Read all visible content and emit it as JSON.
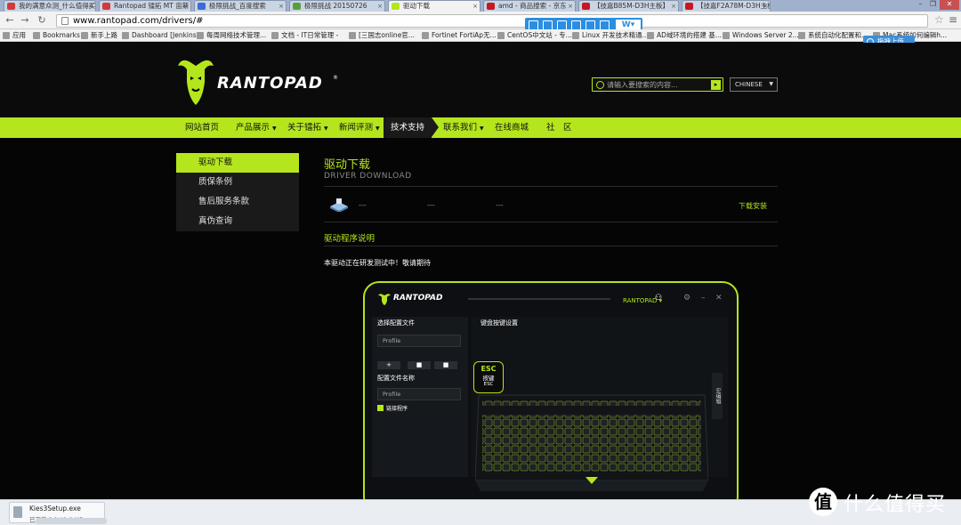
{
  "browser": {
    "tabs": [
      {
        "title": "我的满意众测_什么值得买",
        "fav_color": "#d43a3a"
      },
      {
        "title": "Rantopad 镭拓 MT 宙斯",
        "fav_color": "#d43a3a"
      },
      {
        "title": "极限挑战_百度搜索",
        "fav_color": "#3b6bd6"
      },
      {
        "title": "极限挑战 20150726",
        "fav_color": "#5a9e3c"
      },
      {
        "title": "驱动下载",
        "fav_color": "#b5e61d"
      },
      {
        "title": "amd - 商品搜索 - 京东",
        "fav_color": "#c81623"
      },
      {
        "title": "【技嘉B85M-D3H主板】",
        "fav_color": "#c81623"
      },
      {
        "title": "【技嘉F2A78M-D3H主板】",
        "fav_color": "#c81623"
      }
    ],
    "url": "www.rantopad.com/drivers/#",
    "bookmarks": [
      "应用",
      "Bookmarks",
      "新手上路",
      "Dashboard [Jenkins]",
      "每周网络技术管理...",
      "文档 - IT日常管理 -",
      "[三国志online官...",
      "Fortinet FortiAp无...",
      "CentOS中文站 - 专...",
      "Linux 开发技术精通...",
      "AD域环境的搭建 基...",
      "Windows Server 2...",
      "系统自动化配置和...",
      "Mac系统如何编辑h..."
    ],
    "upload_label": "拖拽上传"
  },
  "site": {
    "brand": "RANTOPAD",
    "search_placeholder": "请输入要搜索的内容...",
    "language": "CHINESE",
    "nav": [
      {
        "label": "网站首页",
        "dropdown": false
      },
      {
        "label": "产品展示",
        "dropdown": true
      },
      {
        "label": "关于镭拓",
        "dropdown": true
      },
      {
        "label": "新闻评测",
        "dropdown": true
      },
      {
        "label": "技术支持",
        "dropdown": false,
        "active": true
      },
      {
        "label": "联系我们",
        "dropdown": true
      },
      {
        "label": "在线商城",
        "dropdown": false
      },
      {
        "label": "社　区",
        "dropdown": false
      }
    ],
    "sidebar": [
      {
        "label": "驱动下载",
        "active": true
      },
      {
        "label": "质保条例"
      },
      {
        "label": "售后服务条款"
      },
      {
        "label": "真伪查询"
      }
    ],
    "main": {
      "title": "驱动下载",
      "subtitle": "DRIVER DOWNLOAD",
      "driver_row": {
        "col1": "---",
        "col2": "---",
        "col3": "---",
        "download": "下载安装"
      },
      "section_title": "驱动程序说明",
      "description": "本驱动正在研发测试中！敬请期待"
    },
    "preview": {
      "brand": "RANTOPAD",
      "profile_selector": "RANTOPAD",
      "left_title": "选择配置文件",
      "profile_field": "Profile",
      "buttons": [
        "+",
        "■",
        "■"
      ],
      "config_name_label": "配置文件名称",
      "config_name_value": "Profile",
      "link_program": "链接程序",
      "right_title": "键盘按键设置",
      "esc_key": "ESC",
      "esc_name": "按键",
      "esc_sub": "ESC",
      "macro": "宏编辑"
    }
  },
  "downloads": {
    "file": "Kies3Setup.exe",
    "progress": "已下载 3.1/41.8 MB，..."
  },
  "watermark": {
    "text": "什么值得买",
    "icon_text": "值"
  },
  "colors": {
    "accent": "#b5e61d",
    "background": "#050505"
  }
}
